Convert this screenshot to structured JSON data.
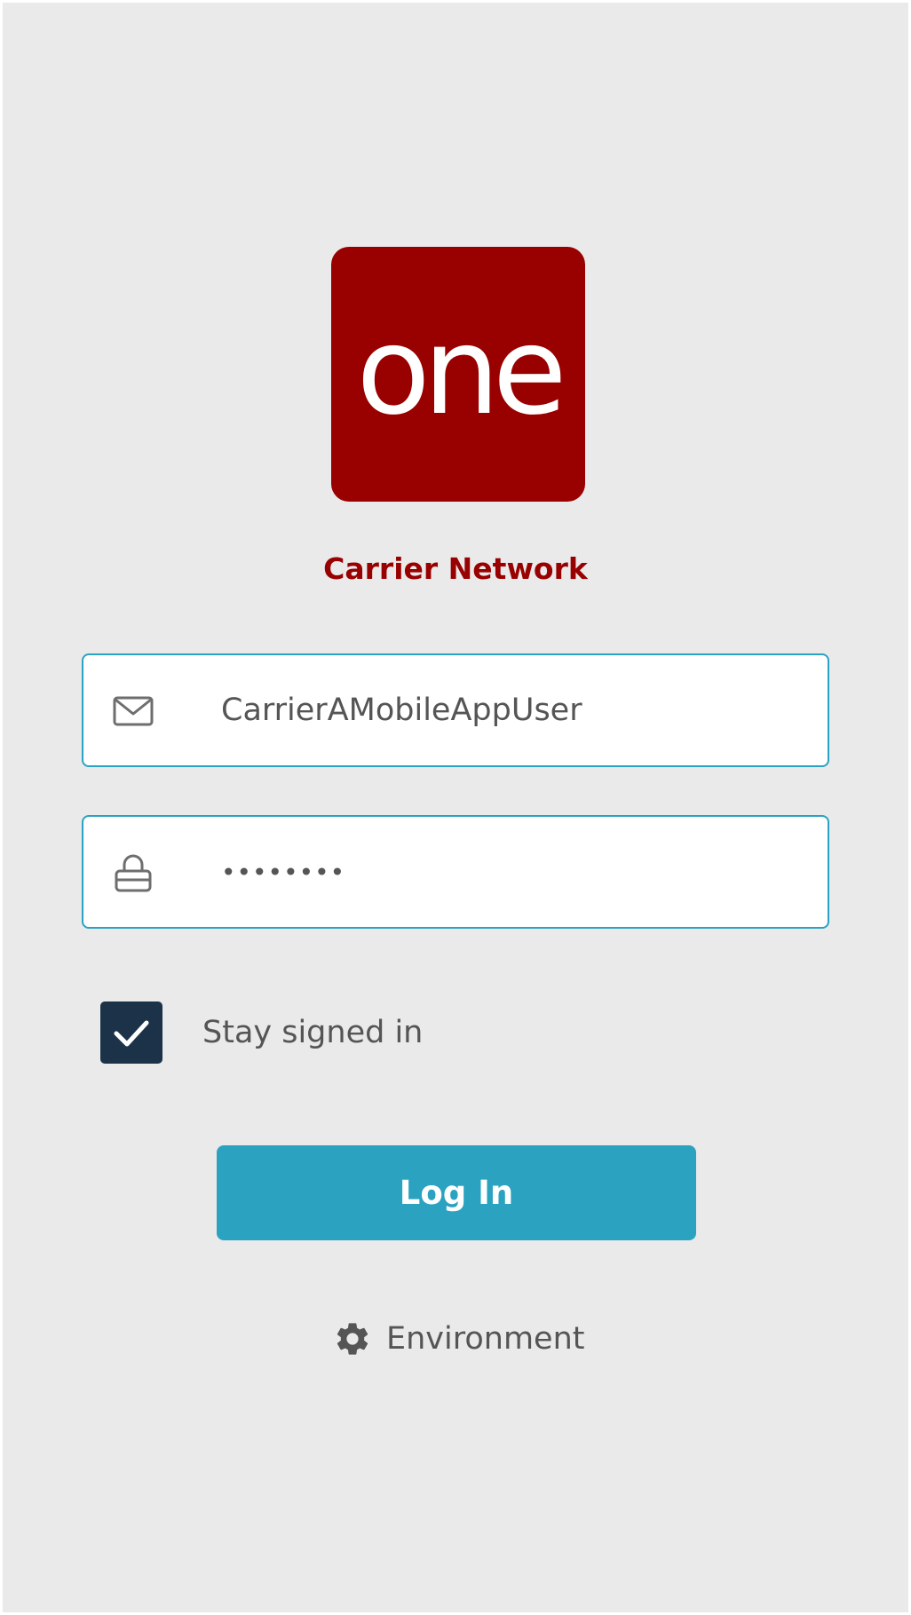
{
  "logo": {
    "text": "one",
    "background_color": "#990000"
  },
  "app": {
    "title": "Carrier Network"
  },
  "login_form": {
    "username": {
      "value": "CarrierAMobileAppUser",
      "icon": "mail-icon"
    },
    "password": {
      "masked_value": "••••••••",
      "icon": "lock-icon"
    },
    "stay_signed_in": {
      "label": "Stay signed in",
      "checked": true
    },
    "login_button": {
      "label": "Log In"
    }
  },
  "environment": {
    "label": "Environment",
    "icon": "gear-icon"
  },
  "colors": {
    "accent": "#2ba3c0",
    "brand": "#990000",
    "checkbox": "#1c3248",
    "background": "#eaeaea"
  }
}
